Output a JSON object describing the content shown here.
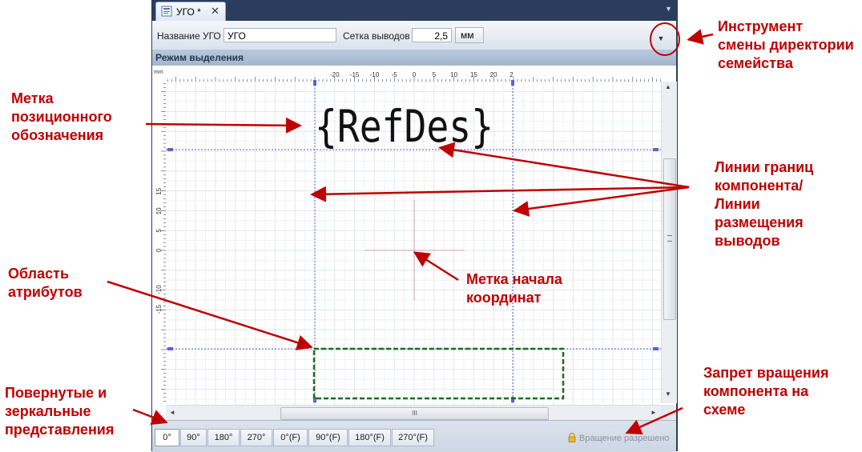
{
  "tab": {
    "label": "УГО *",
    "close": "✕"
  },
  "toolbar": {
    "name_label": "Название УГО",
    "name_value": "УГО",
    "grid_label": "Сетка выводов",
    "grid_value": "2,5",
    "unit_value": "мм"
  },
  "mode": {
    "label": "Режим выделения"
  },
  "ruler": {
    "unit": "mm",
    "x_ticks": [
      "-20",
      "-15",
      "-10",
      "-5",
      "0",
      "5",
      "10",
      "15",
      "20",
      "2"
    ],
    "y_ticks": [
      "15",
      "10",
      "5",
      "0",
      "-10",
      "-15"
    ]
  },
  "canvas": {
    "refdes": "{RefDes}"
  },
  "scroll": {
    "thumb_label": "III"
  },
  "rotations": [
    "0°",
    "90°",
    "180°",
    "270°",
    "0°(F)",
    "90°(F)",
    "180°(F)",
    "270°(F)"
  ],
  "status": {
    "rotation": "Вращение разрешено"
  },
  "annotations": {
    "dir_tool": "Инструмент смены директории семейства",
    "refdes_label": "Метка позиционного обозначения",
    "boundary_lines": "Линии границ компонента/ Линии размещения выводов",
    "origin": "Метка начала координат",
    "attributes": "Область атрибутов",
    "views": "Повернутые и зеркальные представления",
    "rotation_ban": "Запрет вращения компонента на схеме"
  },
  "colors": {
    "annotation": "#c00000",
    "boundary_line": "#4a55c8",
    "attr_area": "#1e6e1e"
  }
}
